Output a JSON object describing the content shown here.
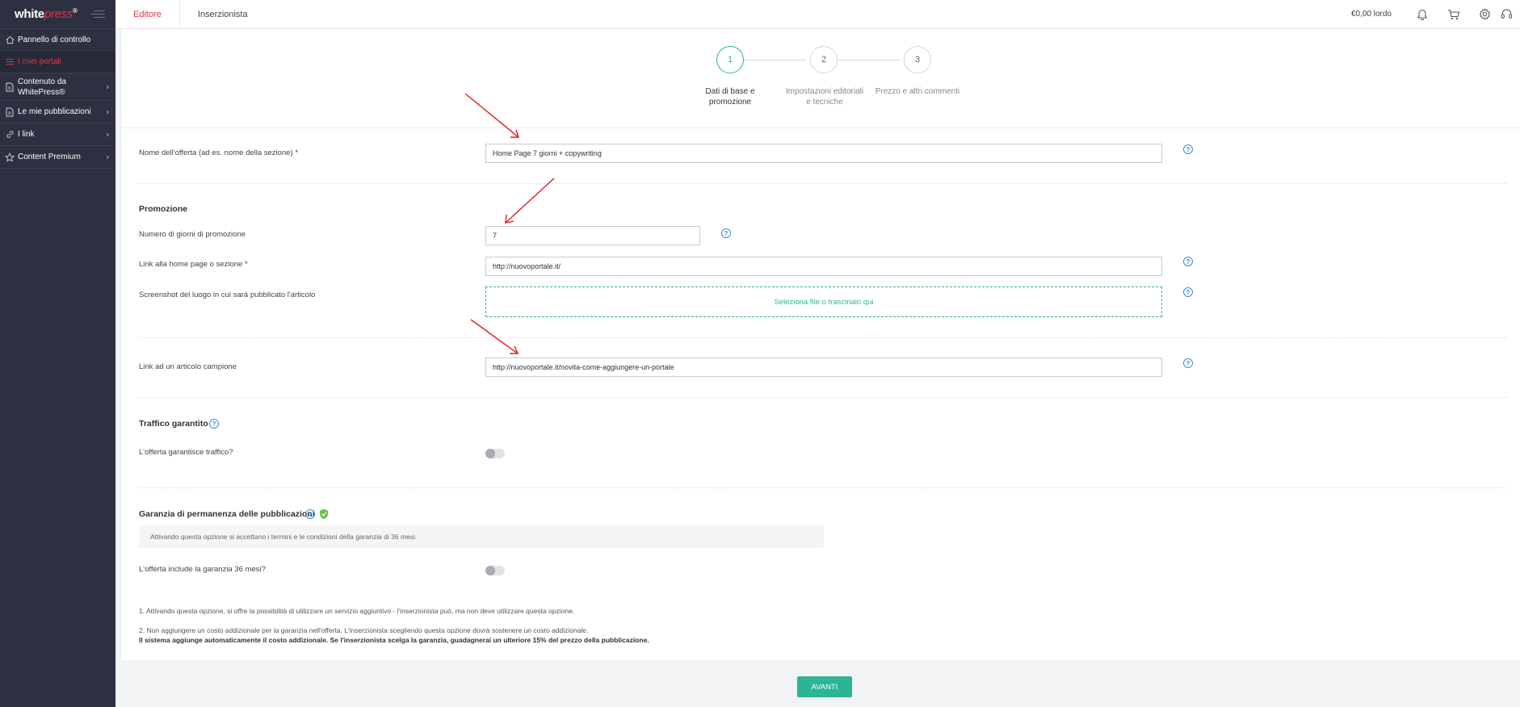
{
  "sidebar": {
    "logo_main": "white",
    "logo_accent": "press",
    "logo_mark": "®",
    "items": [
      {
        "label": "Pannello di controllo",
        "icon": "home-icon"
      },
      {
        "label": "I miei portali",
        "icon": "list-icon"
      },
      {
        "label": "Contenuto da WhitePress®",
        "icon": "document-icon"
      },
      {
        "label": "Le mie pubblicazioni",
        "icon": "document-icon"
      },
      {
        "label": "I link",
        "icon": "link-icon"
      },
      {
        "label": "Content Premium",
        "icon": "star-icon"
      }
    ]
  },
  "topbar": {
    "tabs": [
      "Editore",
      "Inserzionista"
    ],
    "balance": "€0,00 lordo"
  },
  "stepper": {
    "steps": [
      {
        "number": "1",
        "label": "Dati di base e promozione"
      },
      {
        "number": "2",
        "label": "Impostazioni editoriali e tecniche"
      },
      {
        "number": "3",
        "label": "Prezzo e altri commenti"
      }
    ]
  },
  "form": {
    "offer_name_label": "Nome dell'offerta (ad es. nome della sezione) *",
    "offer_name_value": "Home Page 7 giorni + copywriting",
    "promo_title": "Promozione",
    "promo_days_label": "Numero di giorni di promozione",
    "promo_days_value": "7",
    "home_link_label": "Link alla home page o sezione *",
    "home_link_value": "http://nuovoportale.it/",
    "screenshot_label": "Screenshot del luogo in cui sarà pubblicato l'articolo",
    "dropzone_text": "Seleziona file o trascinalo qui",
    "sample_link_label": "Link ad un articolo campione",
    "sample_link_value": "http://nuovoportale.it/novita-come-aggiungere-un-portale",
    "traffic_title": "Traffico garantito",
    "traffic_label": "L'offerta garantisce traffico?",
    "guarantee_title": "Garanzia di permanenza delle pubblicazioni",
    "guarantee_info": "Attivando questa opzione si accettano i termini e le condizioni della garanzia di 36 mesi.",
    "guarantee_label": "L'offerta include la garanzia 36 mesi?",
    "help_mark": "?"
  },
  "notes": {
    "note1": "1.  Attivando questa opzione, si offre la possibilità di utilizzare un servizio aggiuntivo -  l'inserzionista può, ma non deve utilizzare questa opzione.",
    "note2": "2.  Non aggiungere un costo addizionale per la garanzia nell'offerta. L'inserzionista scegliendo questa opzione dovrà sostenere un costo addizionale.",
    "note3": "Il sistema aggiunge automaticamente il costo addizionale. Se l'inserzionista scelga la garanzia, guadagnerai un ulteriore 15% del prezzo della pubblicazione."
  },
  "actions": {
    "next_label": "AVANTI"
  },
  "colors": {
    "accent_red": "#e2344d",
    "accent_green": "#2bb594",
    "sidebar_bg": "#2c3040",
    "help_blue": "#3c8cd6",
    "annotation_arrow": "#e02020"
  }
}
